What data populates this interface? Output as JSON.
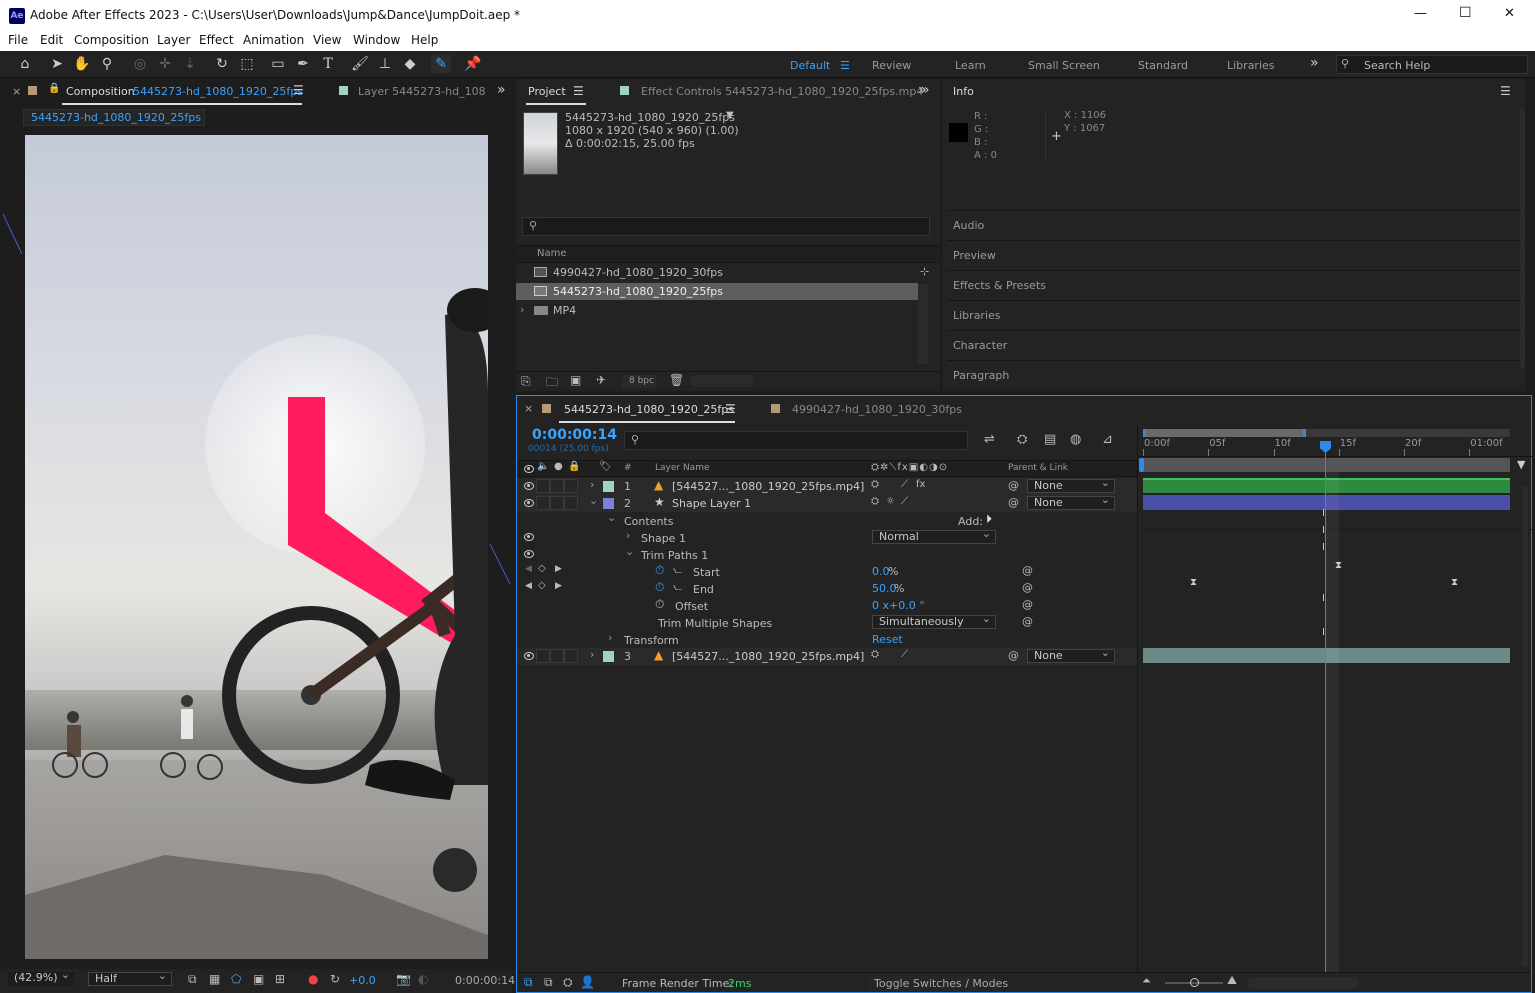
{
  "titlebar": {
    "app_title": "Adobe After Effects 2023 - C:\\Users\\User\\Downloads\\Jump&Dance\\JumpDoit.aep *",
    "logo": "Ae",
    "minimize": "—",
    "maximize": "☐",
    "close": "✕"
  },
  "menu": [
    "File",
    "Edit",
    "Composition",
    "Layer",
    "Effect",
    "Animation",
    "View",
    "Window",
    "Help"
  ],
  "workspaces": {
    "active": "Default",
    "items": [
      "Review",
      "Learn",
      "Small Screen",
      "Standard",
      "Libraries"
    ],
    "more": "»",
    "search_placeholder": "Search Help"
  },
  "comp_panel": {
    "close": "×",
    "tab_prefix": "Composition",
    "tab_name": "5445273-hd_1080_1920_25fps",
    "layer_tab": "Layer  5445273-hd_108",
    "more": "»",
    "subtab": "5445273-hd_1080_1920_25fps",
    "zoom": "(42.9%)",
    "resolution": "Half",
    "exposure": "+0.0",
    "timecode": "0:00:00:14"
  },
  "project_panel": {
    "tab": "Project",
    "effect_controls_tab": "Effect Controls  5445273-hd_1080_1920_25fps.mp4",
    "more": "»",
    "selected_name": "5445273-hd_1080_1920_25fps",
    "selected_size": "1080 x 1920  (540 x 960) (1.00)",
    "selected_duration": "Δ 0:00:02:15, 25.00 fps",
    "col_name": "Name",
    "items": [
      {
        "name": "4990427-hd_1080_1920_30fps",
        "type": "comp",
        "selected": false
      },
      {
        "name": "5445273-hd_1080_1920_25fps",
        "type": "comp",
        "selected": true
      },
      {
        "name": "MP4",
        "type": "folder",
        "selected": false
      }
    ],
    "bpc": "8 bpc"
  },
  "info_panel": {
    "title": "Info",
    "r": "R :",
    "g": "G :",
    "b": "B :",
    "a": "A :  0",
    "x": "X : 1106",
    "y": "Y : 1067",
    "sections": [
      "Audio",
      "Preview",
      "Effects & Presets",
      "Libraries",
      "Character",
      "Paragraph"
    ]
  },
  "timeline": {
    "tab_active": "5445273-hd_1080_1920_25fps",
    "tab_other": "4990427-hd_1080_1920_30fps",
    "current_time": "0:00:00:14",
    "frame_info": "00014 (25.00 fps)",
    "col_num": "#",
    "col_layer_name": "Layer Name",
    "col_parent": "Parent & Link",
    "ruler_labels": [
      "0:00f",
      "05f",
      "10f",
      "15f",
      "20f",
      "01:00f"
    ],
    "ruler_values_frames": [
      0,
      5,
      10,
      15,
      20,
      25
    ],
    "current_frame": 14,
    "layers": [
      {
        "num": "1",
        "name": "[544527..._1080_1920_25fps.mp4]",
        "color": "#9fd3c7",
        "parent": "None",
        "icon": "cone"
      },
      {
        "num": "2",
        "name": "Shape Layer 1",
        "color": "#7b80d9",
        "parent": "None",
        "icon": "star"
      },
      {
        "num": "3",
        "name": "[544527..._1080_1920_25fps.mp4]",
        "color": "#9fd3c7",
        "parent": "None",
        "icon": "cone"
      }
    ],
    "contents": "Contents",
    "add": "Add:",
    "shape1": "Shape 1",
    "blend_mode": "Normal",
    "trim_paths": "Trim Paths 1",
    "start_label": "Start",
    "start_value": "0.0",
    "end_label": "End",
    "end_value": "50.0",
    "percent": "%",
    "offset_label": "Offset",
    "offset_value": "0 x+0.0 °",
    "trim_multiple": "Trim Multiple Shapes",
    "trim_mode": "Simultaneously",
    "transform": "Transform",
    "reset": "Reset",
    "render_time_label": "Frame Render Time:",
    "render_time_value": "2ms",
    "toggle_label": "Toggle Switches / Modes"
  },
  "colors": {
    "accent_blue": "#2d8ceb",
    "shape_pink": "#ff1b5e",
    "layer_green": "#2e8a3f",
    "layer_purple": "#4a4fa8",
    "layer_teal": "#6d8b86"
  }
}
